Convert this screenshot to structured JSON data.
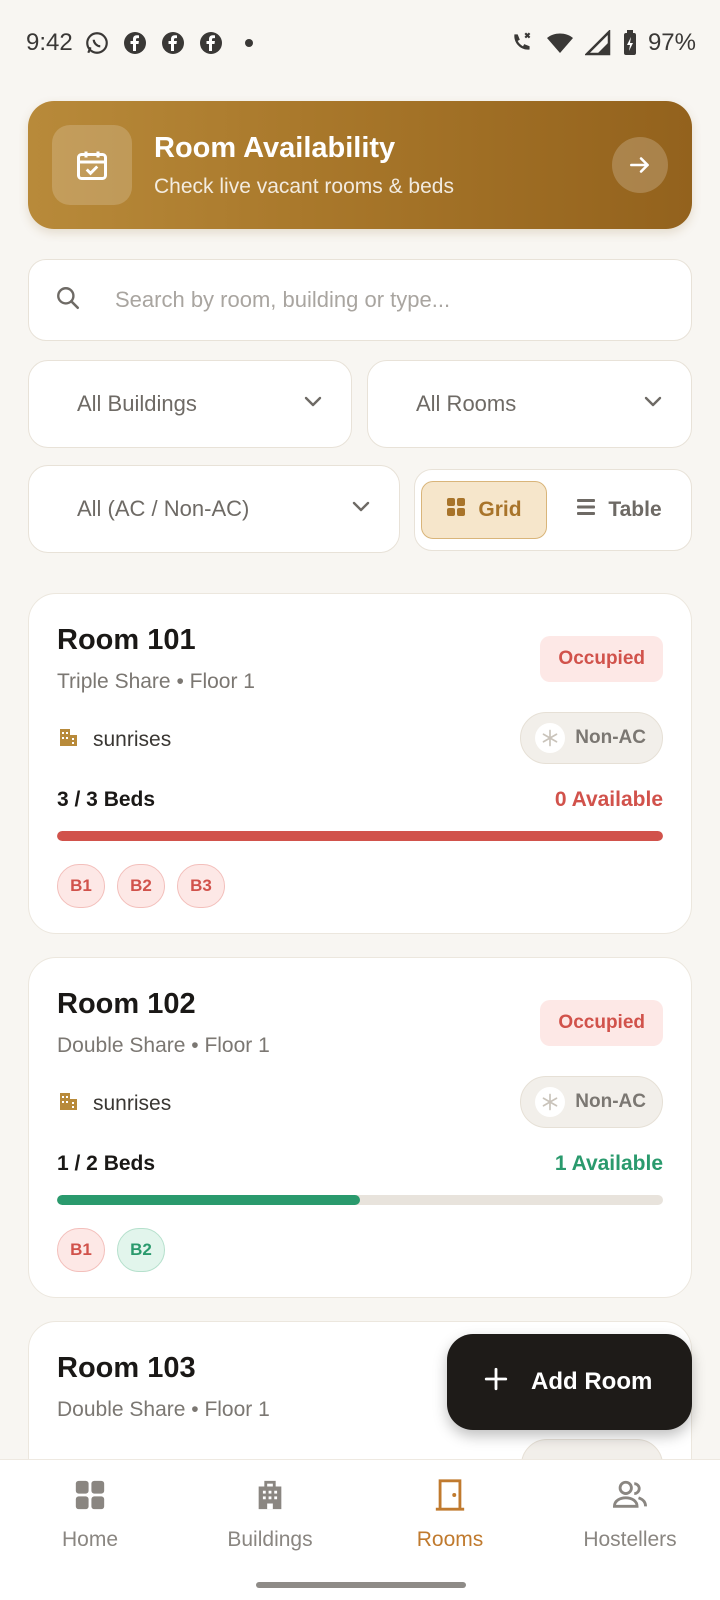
{
  "status_bar": {
    "time": "9:42",
    "battery": "97%"
  },
  "banner": {
    "title": "Room Availability",
    "subtitle": "Check live vacant rooms & beds"
  },
  "search": {
    "placeholder": "Search by room, building or type..."
  },
  "filters": {
    "building": "All Buildings",
    "rooms": "All Rooms",
    "ac": "All (AC / Non-AC)"
  },
  "view_toggle": {
    "grid": "Grid",
    "table": "Table",
    "selected": "Grid"
  },
  "rooms": [
    {
      "title": "Room 101",
      "subtitle": "Triple Share • Floor 1",
      "status": "Occupied",
      "building": "sunrises",
      "ac": "Non-AC",
      "beds": "3 / 3 Beds",
      "available": "0 Available",
      "occupancy_fraction": 1.0,
      "bed_list": [
        {
          "label": "B1",
          "state": "occupied"
        },
        {
          "label": "B2",
          "state": "occupied"
        },
        {
          "label": "B3",
          "state": "occupied"
        }
      ]
    },
    {
      "title": "Room 102",
      "subtitle": "Double Share • Floor 1",
      "status": "Occupied",
      "building": "sunrises",
      "ac": "Non-AC",
      "beds": "1 / 2 Beds",
      "available": "1 Available",
      "occupancy_fraction": 0.5,
      "bed_list": [
        {
          "label": "B1",
          "state": "occupied"
        },
        {
          "label": "B2",
          "state": "free"
        }
      ]
    },
    {
      "title": "Room 103",
      "subtitle": "Double Share • Floor 1"
    }
  ],
  "fab": {
    "label": "Add Room"
  },
  "nav": {
    "home": "Home",
    "buildings": "Buildings",
    "rooms": "Rooms",
    "hostellers": "Hostellers",
    "active": "Rooms"
  },
  "colors": {
    "accent": "#c07a2e",
    "occupied": "#d1524b",
    "available": "#2a9a6d",
    "banner_start": "#b88a3a",
    "banner_end": "#93621d"
  }
}
